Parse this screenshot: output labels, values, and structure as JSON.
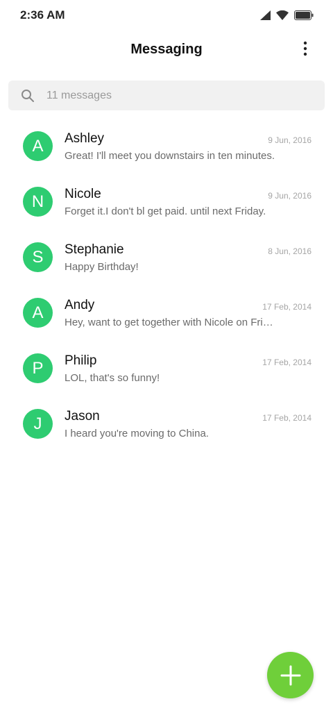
{
  "status_bar": {
    "time": "2:36 AM",
    "icons": [
      "signal-icon",
      "wifi-icon",
      "battery-icon"
    ]
  },
  "header": {
    "title": "Messaging",
    "more_icon": "more-vertical-icon"
  },
  "search": {
    "placeholder": "11 messages",
    "value": "",
    "icon": "search-icon"
  },
  "colors": {
    "avatar": "#2ecc71",
    "fab": "#6fcf3a",
    "search_bg": "#f1f1f1"
  },
  "conversations": [
    {
      "initial": "A",
      "name": "Ashley",
      "date": "9 Jun, 2016",
      "preview": "Great! I'll meet you downstairs in ten minutes."
    },
    {
      "initial": "N",
      "name": "Nicole",
      "date": "9 Jun, 2016",
      "preview": "Forget it.I don't bl get paid. until next Friday."
    },
    {
      "initial": "S",
      "name": "Stephanie",
      "date": "8 Jun, 2016",
      "preview": "Happy Birthday!"
    },
    {
      "initial": "A",
      "name": "Andy",
      "date": "17 Feb, 2014",
      "preview": "Hey, want to get together with Nicole on Friday?"
    },
    {
      "initial": "P",
      "name": "Philip",
      "date": "17 Feb, 2014",
      "preview": "LOL, that's so funny!"
    },
    {
      "initial": "J",
      "name": "Jason",
      "date": "17 Feb, 2014",
      "preview": "I heard you're moving to China."
    }
  ],
  "fab": {
    "icon": "plus-icon"
  }
}
